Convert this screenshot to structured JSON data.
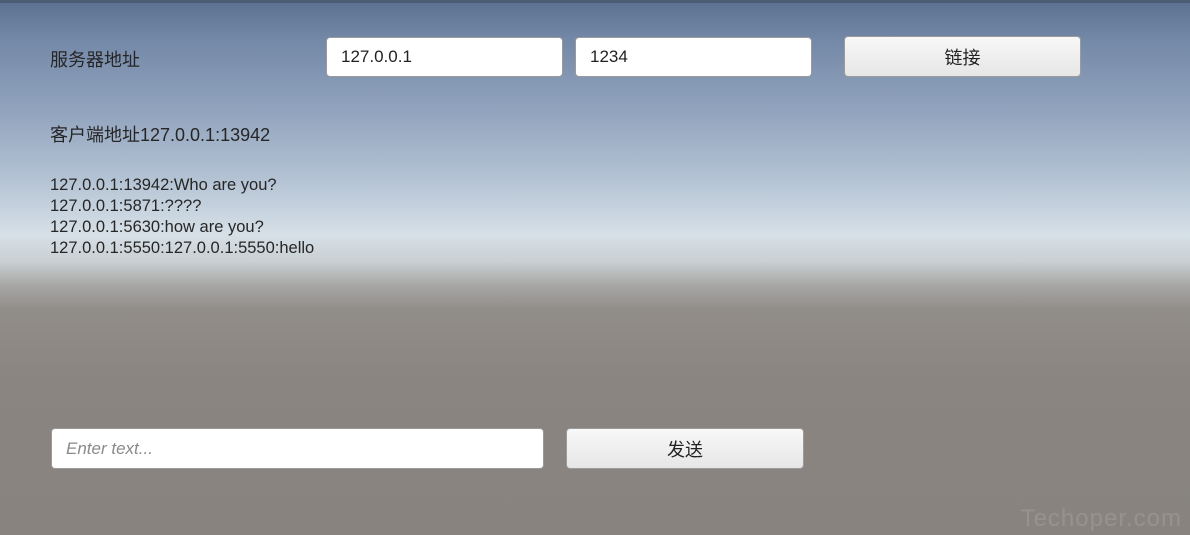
{
  "server": {
    "label": "服务器地址",
    "ip_value": "127.0.0.1",
    "port_value": "1234",
    "connect_label": "链接"
  },
  "client": {
    "address_text": "客户端地址127.0.0.1:13942"
  },
  "messages": [
    "127.0.0.1:13942:Who are you?",
    "127.0.0.1:5871:????",
    "127.0.0.1:5630:how are you?",
    "127.0.0.1:5550:127.0.0.1:5550:hello"
  ],
  "composer": {
    "placeholder": "Enter text...",
    "value": "",
    "send_label": "发送"
  },
  "watermark": "Techoper.com"
}
